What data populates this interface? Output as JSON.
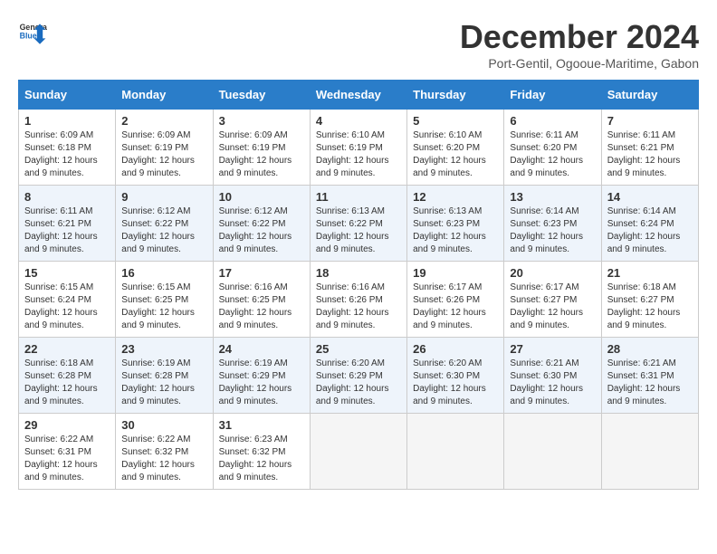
{
  "logo": {
    "line1": "General",
    "line2": "Blue"
  },
  "title": "December 2024",
  "subtitle": "Port-Gentil, Ogooue-Maritime, Gabon",
  "headers": [
    "Sunday",
    "Monday",
    "Tuesday",
    "Wednesday",
    "Thursday",
    "Friday",
    "Saturday"
  ],
  "weeks": [
    [
      {
        "day": "1",
        "sunrise": "6:09 AM",
        "sunset": "6:18 PM",
        "daylight": "12 hours and 9 minutes."
      },
      {
        "day": "2",
        "sunrise": "6:09 AM",
        "sunset": "6:19 PM",
        "daylight": "12 hours and 9 minutes."
      },
      {
        "day": "3",
        "sunrise": "6:09 AM",
        "sunset": "6:19 PM",
        "daylight": "12 hours and 9 minutes."
      },
      {
        "day": "4",
        "sunrise": "6:10 AM",
        "sunset": "6:19 PM",
        "daylight": "12 hours and 9 minutes."
      },
      {
        "day": "5",
        "sunrise": "6:10 AM",
        "sunset": "6:20 PM",
        "daylight": "12 hours and 9 minutes."
      },
      {
        "day": "6",
        "sunrise": "6:11 AM",
        "sunset": "6:20 PM",
        "daylight": "12 hours and 9 minutes."
      },
      {
        "day": "7",
        "sunrise": "6:11 AM",
        "sunset": "6:21 PM",
        "daylight": "12 hours and 9 minutes."
      }
    ],
    [
      {
        "day": "8",
        "sunrise": "6:11 AM",
        "sunset": "6:21 PM",
        "daylight": "12 hours and 9 minutes."
      },
      {
        "day": "9",
        "sunrise": "6:12 AM",
        "sunset": "6:22 PM",
        "daylight": "12 hours and 9 minutes."
      },
      {
        "day": "10",
        "sunrise": "6:12 AM",
        "sunset": "6:22 PM",
        "daylight": "12 hours and 9 minutes."
      },
      {
        "day": "11",
        "sunrise": "6:13 AM",
        "sunset": "6:22 PM",
        "daylight": "12 hours and 9 minutes."
      },
      {
        "day": "12",
        "sunrise": "6:13 AM",
        "sunset": "6:23 PM",
        "daylight": "12 hours and 9 minutes."
      },
      {
        "day": "13",
        "sunrise": "6:14 AM",
        "sunset": "6:23 PM",
        "daylight": "12 hours and 9 minutes."
      },
      {
        "day": "14",
        "sunrise": "6:14 AM",
        "sunset": "6:24 PM",
        "daylight": "12 hours and 9 minutes."
      }
    ],
    [
      {
        "day": "15",
        "sunrise": "6:15 AM",
        "sunset": "6:24 PM",
        "daylight": "12 hours and 9 minutes."
      },
      {
        "day": "16",
        "sunrise": "6:15 AM",
        "sunset": "6:25 PM",
        "daylight": "12 hours and 9 minutes."
      },
      {
        "day": "17",
        "sunrise": "6:16 AM",
        "sunset": "6:25 PM",
        "daylight": "12 hours and 9 minutes."
      },
      {
        "day": "18",
        "sunrise": "6:16 AM",
        "sunset": "6:26 PM",
        "daylight": "12 hours and 9 minutes."
      },
      {
        "day": "19",
        "sunrise": "6:17 AM",
        "sunset": "6:26 PM",
        "daylight": "12 hours and 9 minutes."
      },
      {
        "day": "20",
        "sunrise": "6:17 AM",
        "sunset": "6:27 PM",
        "daylight": "12 hours and 9 minutes."
      },
      {
        "day": "21",
        "sunrise": "6:18 AM",
        "sunset": "6:27 PM",
        "daylight": "12 hours and 9 minutes."
      }
    ],
    [
      {
        "day": "22",
        "sunrise": "6:18 AM",
        "sunset": "6:28 PM",
        "daylight": "12 hours and 9 minutes."
      },
      {
        "day": "23",
        "sunrise": "6:19 AM",
        "sunset": "6:28 PM",
        "daylight": "12 hours and 9 minutes."
      },
      {
        "day": "24",
        "sunrise": "6:19 AM",
        "sunset": "6:29 PM",
        "daylight": "12 hours and 9 minutes."
      },
      {
        "day": "25",
        "sunrise": "6:20 AM",
        "sunset": "6:29 PM",
        "daylight": "12 hours and 9 minutes."
      },
      {
        "day": "26",
        "sunrise": "6:20 AM",
        "sunset": "6:30 PM",
        "daylight": "12 hours and 9 minutes."
      },
      {
        "day": "27",
        "sunrise": "6:21 AM",
        "sunset": "6:30 PM",
        "daylight": "12 hours and 9 minutes."
      },
      {
        "day": "28",
        "sunrise": "6:21 AM",
        "sunset": "6:31 PM",
        "daylight": "12 hours and 9 minutes."
      }
    ],
    [
      {
        "day": "29",
        "sunrise": "6:22 AM",
        "sunset": "6:31 PM",
        "daylight": "12 hours and 9 minutes."
      },
      {
        "day": "30",
        "sunrise": "6:22 AM",
        "sunset": "6:32 PM",
        "daylight": "12 hours and 9 minutes."
      },
      {
        "day": "31",
        "sunrise": "6:23 AM",
        "sunset": "6:32 PM",
        "daylight": "12 hours and 9 minutes."
      },
      null,
      null,
      null,
      null
    ]
  ],
  "labels": {
    "sunrise": "Sunrise:",
    "sunset": "Sunset:",
    "daylight": "Daylight:"
  },
  "colors": {
    "header_bg": "#2a7dc9",
    "row_even": "#eef4fb",
    "row_odd": "#ffffff"
  }
}
